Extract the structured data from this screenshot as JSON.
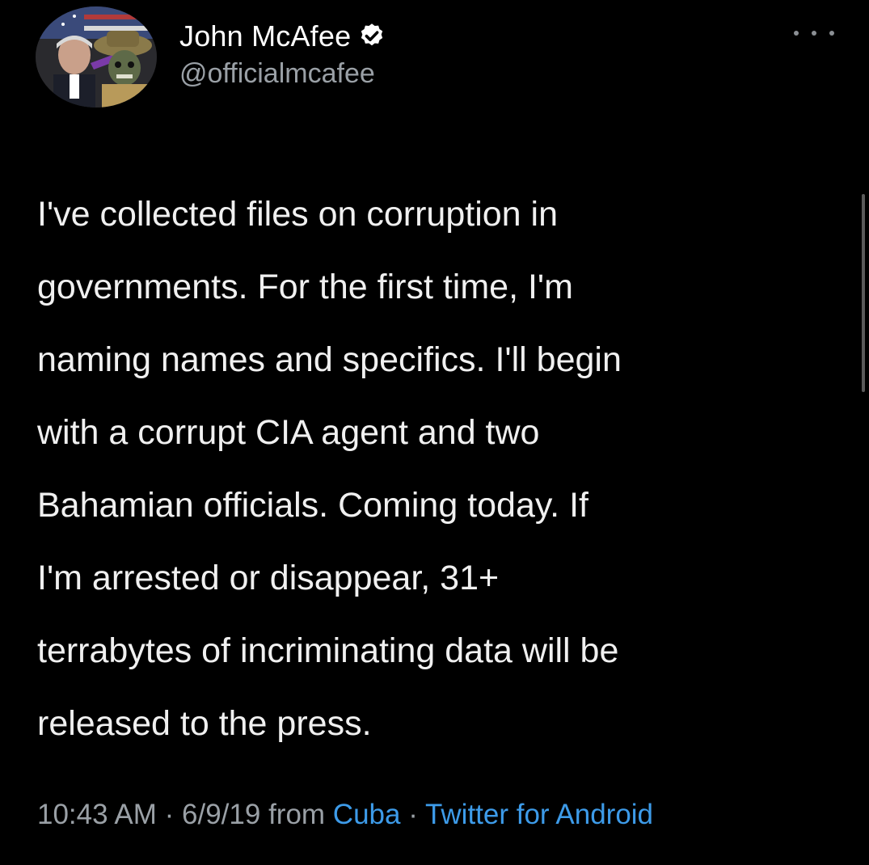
{
  "author": {
    "display_name": "John McAfee",
    "handle": "@officialmcafee",
    "verified": true,
    "avatar_icon": "profile-photo"
  },
  "tweet": {
    "lines": [
      "I've collected files on corruption in",
      "governments. For the first time, I'm",
      "naming names and specifics. I'll begin",
      "with a corrupt CIA agent and two",
      "Bahamian officials. Coming today. If",
      "I'm arrested or disappear, 31+",
      "terrabytes of incriminating data will be",
      "released to the press."
    ]
  },
  "meta": {
    "time": "10:43 AM",
    "date": "6/9/19",
    "from_label": "from",
    "location": "Cuba",
    "client": "Twitter for Android",
    "separator": "·"
  },
  "icons": {
    "more": "more-horizontal-icon",
    "verified": "verified-badge-icon"
  },
  "colors": {
    "background": "#000000",
    "text": "#f0f0f0",
    "secondary": "#9aa0a6",
    "link": "#3d9be9"
  }
}
